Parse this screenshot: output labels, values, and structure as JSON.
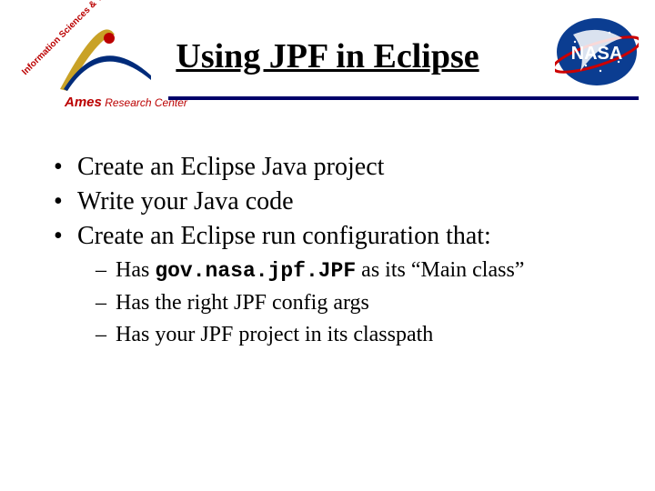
{
  "header": {
    "title": "Using JPF in Eclipse",
    "ames_arc_text": "Information Sciences & Technology",
    "ames_label_bold": "Ames",
    "ames_label_rest": " Research Center",
    "nasa_text": "NASA"
  },
  "bullets": [
    {
      "text": "Create an Eclipse Java project"
    },
    {
      "text": "Write your Java code"
    },
    {
      "text": "Create an Eclipse run configuration that:",
      "sub": [
        {
          "pre": "Has ",
          "code": "gov.nasa.jpf.JPF",
          "post": " as its “Main class”"
        },
        {
          "pre": "Has the right JPF config args",
          "code": "",
          "post": ""
        },
        {
          "pre": "Has your JPF project in its classpath",
          "code": "",
          "post": ""
        }
      ]
    }
  ]
}
